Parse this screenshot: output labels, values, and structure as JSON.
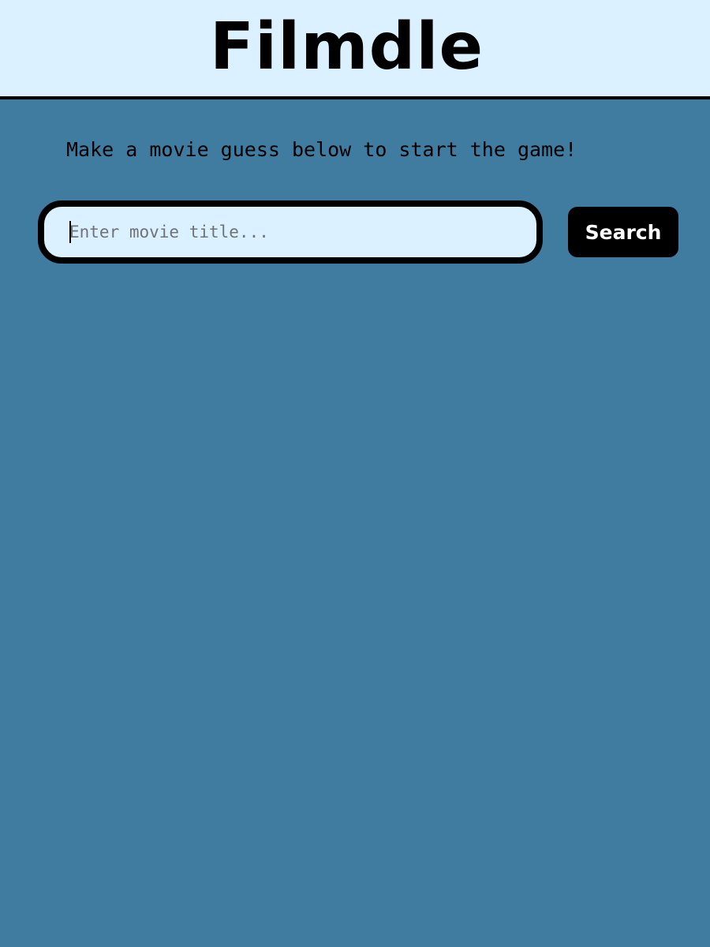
{
  "header": {
    "title": "Filmdle"
  },
  "main": {
    "intro_text": "Make a movie guess below to start the game!",
    "search": {
      "value": "",
      "placeholder": "Enter movie title...",
      "button_label": "Search"
    }
  },
  "colors": {
    "header_background": "#dcf1ff",
    "page_background": "#407ba0",
    "input_background": "#dcf1ff",
    "button_background": "#000000",
    "button_text": "#ffffff",
    "text": "#000000"
  }
}
